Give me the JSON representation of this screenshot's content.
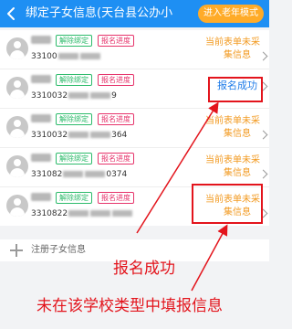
{
  "header": {
    "title": "绑定子女信息(天台县公办小",
    "elder_mode_label": "进入老年模式"
  },
  "children": [
    {
      "id_prefix": "33100",
      "id_suffix": "",
      "unbind_label": "解除绑定",
      "progress_label": "报名进度",
      "status_line1": "当前表单未采",
      "status_line2": "集信息"
    },
    {
      "id_prefix": "3310032",
      "id_suffix": "9",
      "unbind_label": "解除绑定",
      "progress_label": "报名进度",
      "status": "报名成功"
    },
    {
      "id_prefix": "3310032",
      "id_suffix": "364",
      "unbind_label": "解除绑定",
      "progress_label": "报名进度",
      "status_line1": "当前表单未采",
      "status_line2": "集信息"
    },
    {
      "id_prefix": "331082",
      "id_suffix": "0374",
      "unbind_label": "解除绑定",
      "progress_label": "报名进度",
      "status_line1": "当前表单未采",
      "status_line2": "集信息"
    },
    {
      "id_prefix": "3310822",
      "id_suffix": "",
      "unbind_label": "解除绑定",
      "progress_label": "报名进度",
      "status_line1": "当前表单未采",
      "status_line2": "集信息"
    }
  ],
  "register": {
    "label": "注册子女信息"
  },
  "annotations": {
    "success_note": "报名成功",
    "not_filled_note": "未在该学校类型中填报信息",
    "color": "#e3141c"
  },
  "colors": {
    "header": "#1e8ff3",
    "elder_button": "#ffab28",
    "unbind": "#2dbb6b",
    "progress": "#e6336b",
    "pending": "#f29a21",
    "success": "#1e7be8"
  }
}
